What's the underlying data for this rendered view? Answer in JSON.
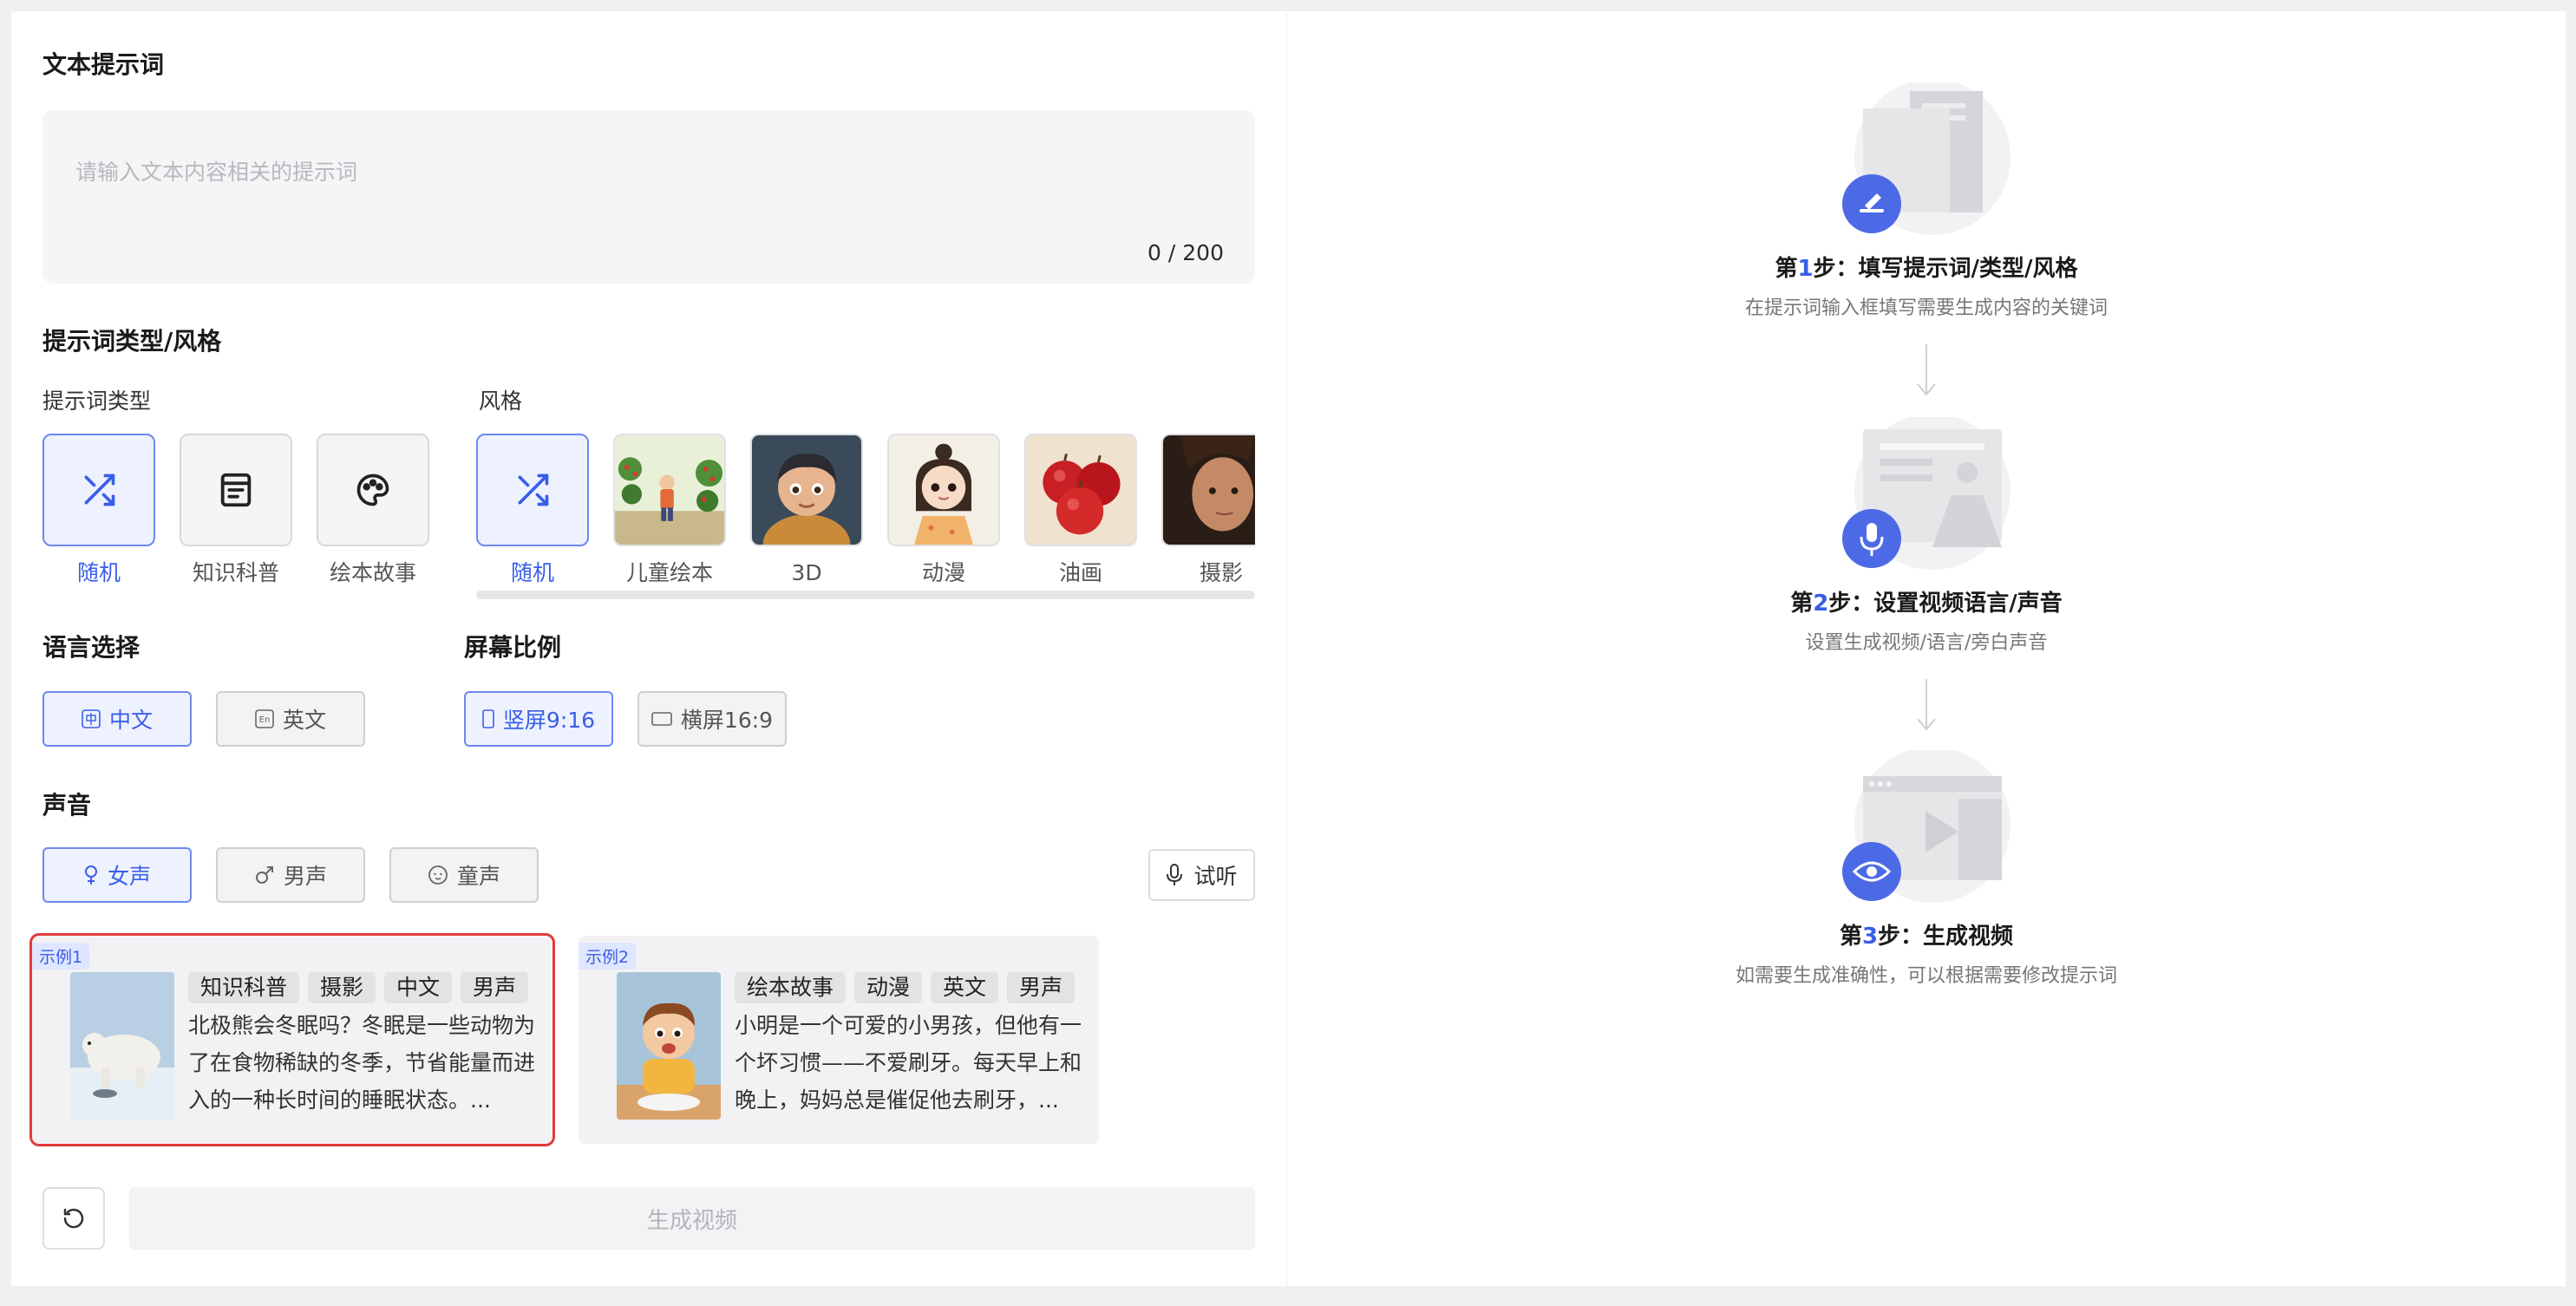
{
  "left": {
    "prompt": {
      "title": "文本提示词",
      "placeholder": "请输入文本内容相关的提示词",
      "counter": "0 / 200"
    },
    "type_style": {
      "title": "提示词类型/风格",
      "type_label": "提示词类型",
      "style_label": "风格",
      "types": [
        {
          "label": "随机",
          "icon": "shuffle-icon",
          "active": true
        },
        {
          "label": "知识科普",
          "icon": "document-icon",
          "active": false
        },
        {
          "label": "绘本故事",
          "icon": "palette-icon",
          "active": false
        }
      ],
      "styles": [
        {
          "label": "随机",
          "icon": "shuffle-icon",
          "active": true
        },
        {
          "label": "儿童绘本"
        },
        {
          "label": "3D"
        },
        {
          "label": "动漫"
        },
        {
          "label": "油画"
        },
        {
          "label": "摄影"
        }
      ]
    },
    "language": {
      "title": "语言选择",
      "options": [
        {
          "label": "中文",
          "icon": "chinese-icon",
          "active": true
        },
        {
          "label": "英文",
          "icon": "english-icon",
          "active": false
        }
      ]
    },
    "ratio": {
      "title": "屏幕比例",
      "options": [
        {
          "label": "竖屏9:16",
          "icon": "portrait-icon",
          "active": true
        },
        {
          "label": "横屏16:9",
          "icon": "landscape-icon",
          "active": false
        }
      ]
    },
    "voice": {
      "title": "声音",
      "options": [
        {
          "label": "女声",
          "icon": "female-icon",
          "active": true
        },
        {
          "label": "男声",
          "icon": "male-icon",
          "active": false
        },
        {
          "label": "童声",
          "icon": "child-icon",
          "active": false
        }
      ],
      "listen_label": "试听"
    },
    "examples": [
      {
        "badge": "示例1",
        "tags": [
          "知识科普",
          "摄影",
          "中文",
          "男声"
        ],
        "text": "北极熊会冬眠吗？冬眠是一些动物为了在食物稀缺的冬季，节省能量而进入的一种长时间的睡眠状态。..."
      },
      {
        "badge": "示例2",
        "tags": [
          "绘本故事",
          "动漫",
          "英文",
          "男声"
        ],
        "text": "小明是一个可爱的小男孩，但他有一个坏习惯——不爱刷牙。每天早上和晚上，妈妈总是催促他去刷牙，..."
      }
    ],
    "generate_label": "生成视频"
  },
  "steps": [
    {
      "prefix": "第",
      "num": "1",
      "suffix": "步：填写提示词/类型/风格",
      "desc": "在提示词输入框填写需要生成内容的关键词",
      "icon": "edit-icon"
    },
    {
      "prefix": "第",
      "num": "2",
      "suffix": "步：设置视频语言/声音",
      "desc": "设置生成视频/语言/旁白声音",
      "icon": "microphone-icon"
    },
    {
      "prefix": "第",
      "num": "3",
      "suffix": "步：生成视频",
      "desc": "如需要生成准确性，可以根据需要修改提示词",
      "icon": "eye-icon"
    }
  ],
  "colors": {
    "accent": "#3a5ee8",
    "active_bg": "#eef2ff",
    "highlight": "#e23b3b"
  }
}
